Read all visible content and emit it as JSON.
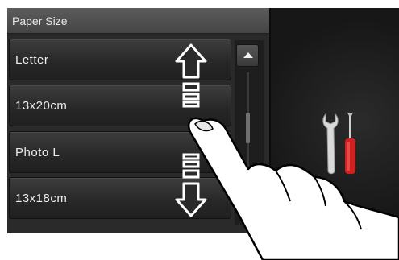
{
  "header": {
    "title": "Paper Size"
  },
  "list": {
    "items": [
      {
        "label": "Letter"
      },
      {
        "label": "13x20cm"
      },
      {
        "label": "Photo L"
      },
      {
        "label": "13x18cm"
      }
    ]
  },
  "icons": {
    "scroll_up": "triangle-up-icon",
    "swipe_up": "swipe-up-arrow-icon",
    "swipe_down": "swipe-down-arrow-icon",
    "settings": "wrench-screwdriver-icon",
    "hand": "pointing-hand-icon"
  },
  "colors": {
    "screen_bg": "#1b1b1b",
    "header_bg": "#4f4f4f",
    "text": "#ededed",
    "screwdriver_handle": "#d12020"
  }
}
